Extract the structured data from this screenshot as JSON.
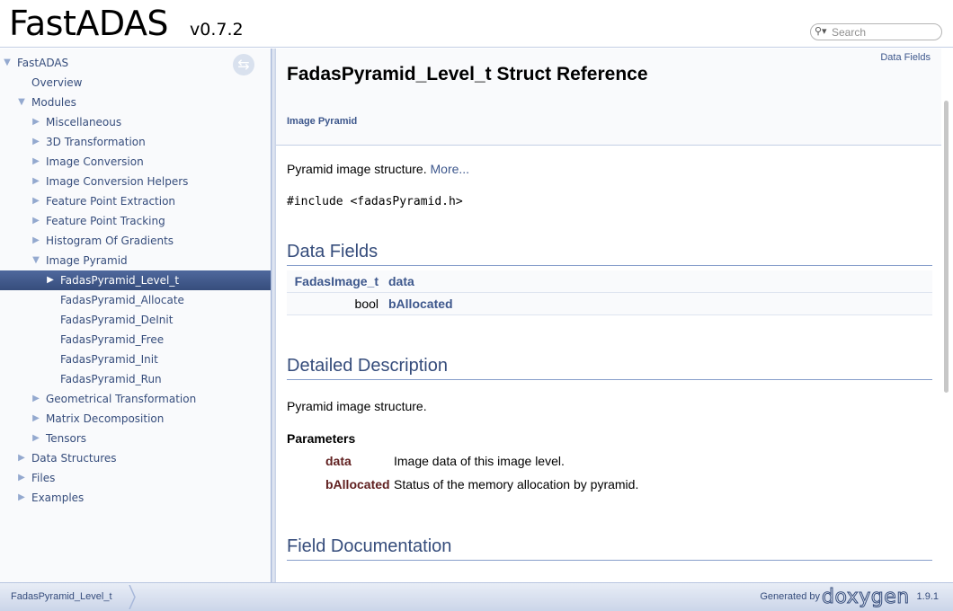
{
  "header": {
    "project_name": "FastADAS",
    "project_number": "v0.7.2",
    "search_placeholder": "Search",
    "search_icon": "magnifier-dropdown-icon"
  },
  "sidebar": {
    "sync_icon": "sync-arrows-icon",
    "items": [
      {
        "label": "FastADAS",
        "arrow": "▼"
      },
      {
        "label": "Overview",
        "arrow": ""
      },
      {
        "label": "Modules",
        "arrow": "▼"
      },
      {
        "label": "Miscellaneous",
        "arrow": "▶"
      },
      {
        "label": "3D Transformation",
        "arrow": "▶"
      },
      {
        "label": "Image Conversion",
        "arrow": "▶"
      },
      {
        "label": "Image Conversion Helpers",
        "arrow": "▶"
      },
      {
        "label": "Feature Point Extraction",
        "arrow": "▶"
      },
      {
        "label": "Feature Point Tracking",
        "arrow": "▶"
      },
      {
        "label": "Histogram Of Gradients",
        "arrow": "▶"
      },
      {
        "label": "Image Pyramid",
        "arrow": "▼"
      },
      {
        "label": "FadasPyramid_Level_t",
        "arrow": "▶",
        "selected": true
      },
      {
        "label": "FadasPyramid_Allocate",
        "arrow": ""
      },
      {
        "label": "FadasPyramid_DeInit",
        "arrow": ""
      },
      {
        "label": "FadasPyramid_Free",
        "arrow": ""
      },
      {
        "label": "FadasPyramid_Init",
        "arrow": ""
      },
      {
        "label": "FadasPyramid_Run",
        "arrow": ""
      },
      {
        "label": "Geometrical Transformation",
        "arrow": "▶"
      },
      {
        "label": "Matrix Decomposition",
        "arrow": "▶"
      },
      {
        "label": "Tensors",
        "arrow": "▶"
      },
      {
        "label": "Data Structures",
        "arrow": "▶"
      },
      {
        "label": "Files",
        "arrow": "▶"
      },
      {
        "label": "Examples",
        "arrow": "▶"
      }
    ]
  },
  "content": {
    "summary_link": "Data Fields",
    "title": "FadasPyramid_Level_t Struct Reference",
    "ingroups": "Image Pyramid",
    "brief": "Pyramid image structure.",
    "more_link": "More...",
    "include": "#include <fadasPyramid.h>",
    "data_fields_heading": "Data Fields",
    "members": [
      {
        "type": "FadasImage_t",
        "name": "data"
      },
      {
        "type": "bool",
        "name": "bAllocated"
      }
    ],
    "detailed_heading": "Detailed Description",
    "detailed_text": "Pyramid image structure.",
    "params_label": "Parameters",
    "params": [
      {
        "name": "data",
        "desc": "Image data of this image level."
      },
      {
        "name": "bAllocated",
        "desc": "Status of the memory allocation by pyramid."
      }
    ],
    "field_doc_heading": "Field Documentation"
  },
  "footer": {
    "nav_path": "FadasPyramid_Level_t",
    "generated_by": "Generated by",
    "doxygen": "doxygen",
    "version": "1.9.1"
  },
  "colors": {
    "link": "#3d578c",
    "heading": "#354c7b",
    "param_name": "#602020",
    "selected_bg": "#364d7c"
  }
}
